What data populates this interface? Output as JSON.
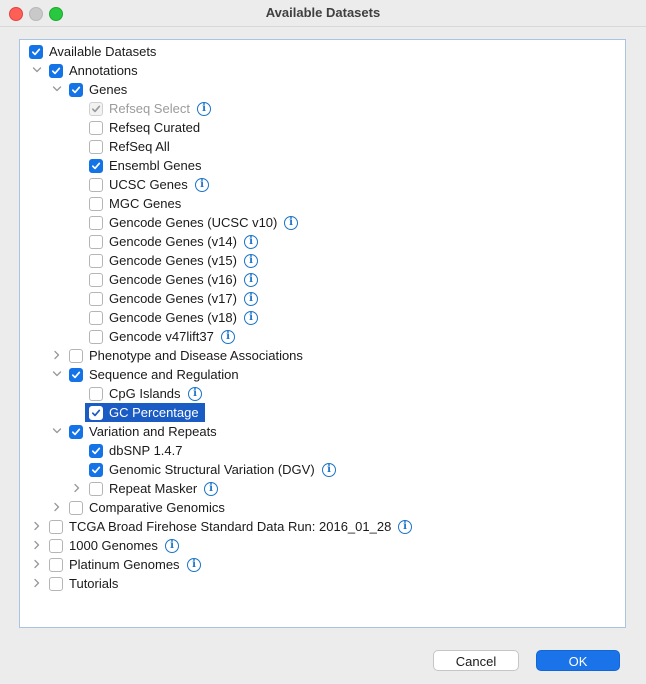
{
  "window": {
    "title": "Available Datasets"
  },
  "tree": [
    {
      "label": "Available Datasets",
      "checked": true,
      "level": 0,
      "expander": "none",
      "info": false,
      "disabled": false,
      "selected": false
    },
    {
      "label": "Annotations",
      "checked": true,
      "level": 1,
      "expander": "expanded",
      "info": false,
      "disabled": false,
      "selected": false
    },
    {
      "label": "Genes",
      "checked": true,
      "level": 2,
      "expander": "expanded",
      "info": false,
      "disabled": false,
      "selected": false
    },
    {
      "label": "Refseq Select",
      "checked": true,
      "level": 3,
      "expander": "none",
      "info": true,
      "disabled": true,
      "selected": false
    },
    {
      "label": "Refseq Curated",
      "checked": false,
      "level": 3,
      "expander": "none",
      "info": false,
      "disabled": false,
      "selected": false
    },
    {
      "label": "RefSeq All",
      "checked": false,
      "level": 3,
      "expander": "none",
      "info": false,
      "disabled": false,
      "selected": false
    },
    {
      "label": "Ensembl Genes",
      "checked": true,
      "level": 3,
      "expander": "none",
      "info": false,
      "disabled": false,
      "selected": false
    },
    {
      "label": "UCSC Genes",
      "checked": false,
      "level": 3,
      "expander": "none",
      "info": true,
      "disabled": false,
      "selected": false
    },
    {
      "label": "MGC Genes",
      "checked": false,
      "level": 3,
      "expander": "none",
      "info": false,
      "disabled": false,
      "selected": false
    },
    {
      "label": "Gencode Genes (UCSC v10)",
      "checked": false,
      "level": 3,
      "expander": "none",
      "info": true,
      "disabled": false,
      "selected": false
    },
    {
      "label": "Gencode Genes (v14)",
      "checked": false,
      "level": 3,
      "expander": "none",
      "info": true,
      "disabled": false,
      "selected": false
    },
    {
      "label": "Gencode Genes (v15)",
      "checked": false,
      "level": 3,
      "expander": "none",
      "info": true,
      "disabled": false,
      "selected": false
    },
    {
      "label": "Gencode Genes (v16)",
      "checked": false,
      "level": 3,
      "expander": "none",
      "info": true,
      "disabled": false,
      "selected": false
    },
    {
      "label": "Gencode Genes (v17)",
      "checked": false,
      "level": 3,
      "expander": "none",
      "info": true,
      "disabled": false,
      "selected": false
    },
    {
      "label": "Gencode Genes (v18)",
      "checked": false,
      "level": 3,
      "expander": "none",
      "info": true,
      "disabled": false,
      "selected": false
    },
    {
      "label": "Gencode v47lift37",
      "checked": false,
      "level": 3,
      "expander": "none",
      "info": true,
      "disabled": false,
      "selected": false
    },
    {
      "label": "Phenotype and Disease Associations",
      "checked": false,
      "level": 2,
      "expander": "collapsed",
      "info": false,
      "disabled": false,
      "selected": false
    },
    {
      "label": "Sequence and Regulation",
      "checked": true,
      "level": 2,
      "expander": "expanded",
      "info": false,
      "disabled": false,
      "selected": false
    },
    {
      "label": "CpG Islands",
      "checked": false,
      "level": 3,
      "expander": "none",
      "info": true,
      "disabled": false,
      "selected": false
    },
    {
      "label": "GC Percentage",
      "checked": true,
      "level": 3,
      "expander": "none",
      "info": false,
      "disabled": false,
      "selected": true
    },
    {
      "label": "Variation and Repeats",
      "checked": true,
      "level": 2,
      "expander": "expanded",
      "info": false,
      "disabled": false,
      "selected": false
    },
    {
      "label": "dbSNP 1.4.7",
      "checked": true,
      "level": 3,
      "expander": "none",
      "info": false,
      "disabled": false,
      "selected": false
    },
    {
      "label": "Genomic Structural Variation (DGV)",
      "checked": true,
      "level": 3,
      "expander": "none",
      "info": true,
      "disabled": false,
      "selected": false
    },
    {
      "label": "Repeat Masker",
      "checked": false,
      "level": 3,
      "expander": "collapsed",
      "info": true,
      "disabled": false,
      "selected": false
    },
    {
      "label": "Comparative Genomics",
      "checked": false,
      "level": 2,
      "expander": "collapsed",
      "info": false,
      "disabled": false,
      "selected": false
    },
    {
      "label": "TCGA Broad Firehose Standard Data Run: 2016_01_28",
      "checked": false,
      "level": 1,
      "expander": "collapsed",
      "info": true,
      "disabled": false,
      "selected": false
    },
    {
      "label": "1000 Genomes",
      "checked": false,
      "level": 1,
      "expander": "collapsed",
      "info": true,
      "disabled": false,
      "selected": false
    },
    {
      "label": "Platinum Genomes",
      "checked": false,
      "level": 1,
      "expander": "collapsed",
      "info": true,
      "disabled": false,
      "selected": false
    },
    {
      "label": "Tutorials",
      "checked": false,
      "level": 1,
      "expander": "collapsed",
      "info": false,
      "disabled": false,
      "selected": false
    }
  ],
  "icons": {
    "info": "i"
  },
  "colors": {
    "accent": "#1473e6",
    "selection": "#1a5bc4",
    "info": "#1a73c8"
  },
  "buttons": {
    "cancel_label": "Cancel",
    "ok_label": "OK"
  }
}
